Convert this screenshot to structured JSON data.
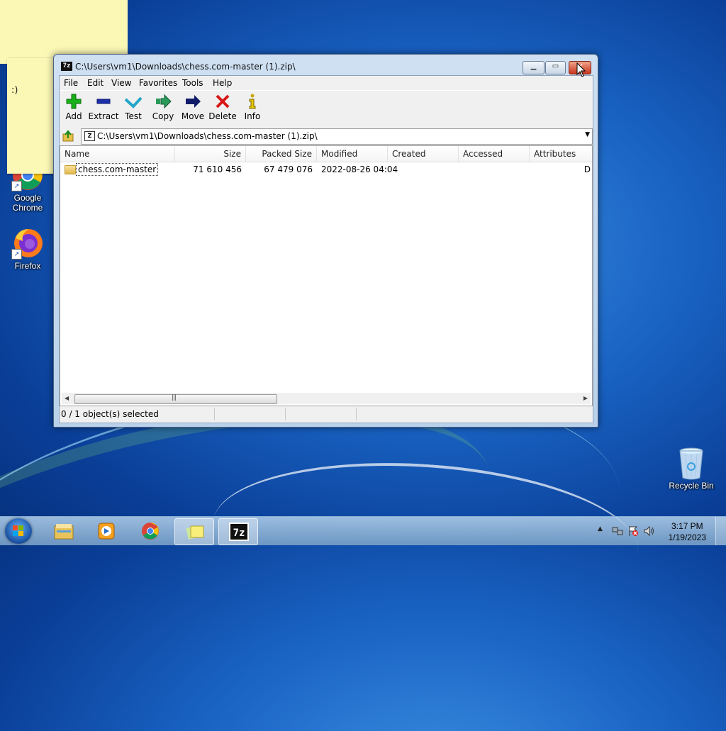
{
  "sticky": {
    "text": ":)"
  },
  "desktop_icons": [
    {
      "label": "Google Chrome",
      "line1": "Google",
      "line2": "Chrome"
    },
    {
      "label": "Firefox"
    },
    {
      "label": "Recycle Bin"
    }
  ],
  "window": {
    "title": "C:\\Users\\vm1\\Downloads\\chess.com-master (1).zip\\",
    "title_icon": "7z",
    "menu": [
      "File",
      "Edit",
      "View",
      "Favorites",
      "Tools",
      "Help"
    ],
    "toolbar": [
      {
        "label": "Add",
        "icon": "plus-icon",
        "color": "#18b018"
      },
      {
        "label": "Extract",
        "icon": "minus-icon",
        "color": "#1c2fa8"
      },
      {
        "label": "Test",
        "icon": "check-icon",
        "color": "#22a6c8"
      },
      {
        "label": "Copy",
        "icon": "copy-arrow-icon",
        "color": "#2a9a5a"
      },
      {
        "label": "Move",
        "icon": "move-arrow-icon",
        "color": "#101c6a"
      },
      {
        "label": "Delete",
        "icon": "x-icon",
        "color": "#d81818"
      },
      {
        "label": "Info",
        "icon": "info-icon",
        "color": "#c8a800"
      }
    ],
    "address": "C:\\Users\\vm1\\Downloads\\chess.com-master (1).zip\\",
    "columns": [
      "Name",
      "Size",
      "Packed Size",
      "Modified",
      "Created",
      "Accessed",
      "Attributes"
    ],
    "rows": [
      {
        "name": "chess.com-master",
        "size": "71 610 456",
        "packed": "67 479 076",
        "modified": "2022-08-26 04:04",
        "created": "",
        "accessed": "",
        "attributes": "D"
      }
    ],
    "status": "0 / 1 object(s) selected"
  },
  "taskbar": {
    "clock_time": "3:17 PM",
    "clock_date": "1/19/2023"
  }
}
